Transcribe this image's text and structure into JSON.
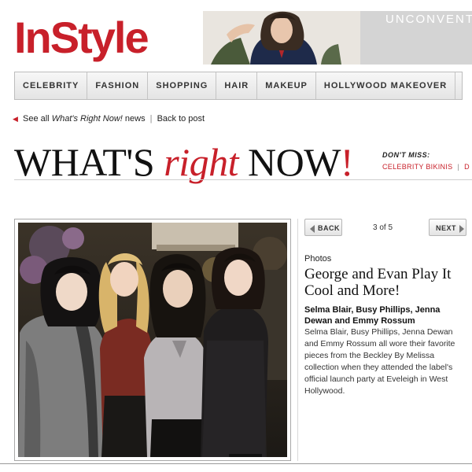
{
  "header": {
    "logo_text": "InStyle",
    "banner_text": "UNCONVENTI"
  },
  "nav": {
    "items": [
      "CELEBRITY",
      "FASHION",
      "SHOPPING",
      "HAIR",
      "MAKEUP",
      "HOLLYWOOD MAKEOVER"
    ]
  },
  "breadcrumb": {
    "see_all_prefix": "See all",
    "see_all_section": "What's Right Now!",
    "see_all_suffix": "news",
    "back_to_post": "Back to post"
  },
  "headline": {
    "part1": "WHAT'S ",
    "part2": "right",
    "part3": " NOW",
    "part4": "!"
  },
  "dont_miss": {
    "label": "DON'T MISS:",
    "links": [
      "CELEBRITY BIKINIS",
      "D"
    ]
  },
  "gallery": {
    "back_label": "BACK",
    "next_label": "NEXT",
    "counter": "3 of 5",
    "category": "Photos",
    "title": "George and Evan Play It Cool and More!",
    "subtitle": "Selma Blair, Busy Phillips, Jenna Dewan and Emmy Rossum",
    "description": "Selma Blair, Busy Phillips, Jenna Dewan and Emmy Rossum all wore their favorite pieces from the Beckley By Melissa collection when they attended the label's official launch party at Eveleigh in West Hollywood."
  },
  "colors": {
    "brand_red": "#c8202a",
    "nav_bg": "#ececec",
    "text": "#222222"
  }
}
